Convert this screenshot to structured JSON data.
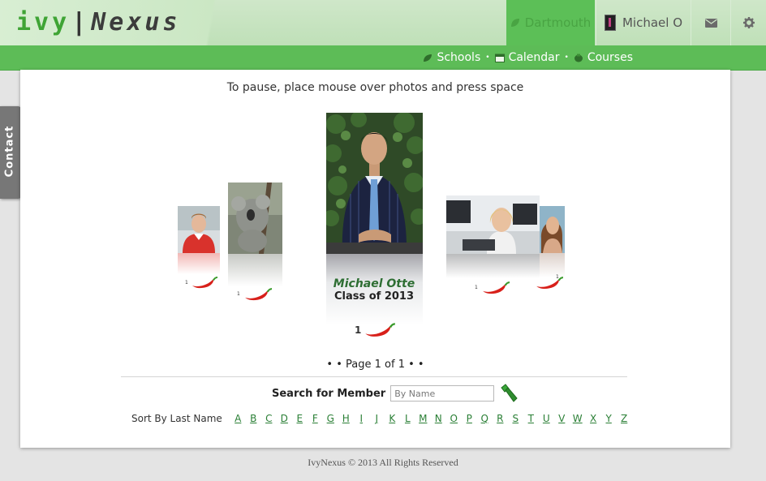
{
  "header": {
    "logo_ivy": "ivy",
    "logo_sep": "|",
    "logo_nexus": "Nexus",
    "school_tab": "Dartmouth",
    "user_tab": "Michael O",
    "mail_icon": "envelope-icon",
    "settings_icon": "gear-icon"
  },
  "subnav": {
    "schools": "Schools",
    "calendar": "Calendar",
    "courses": "Courses",
    "separator": "•"
  },
  "main": {
    "instructions": "To pause, place mouse over photos and press space",
    "featured": {
      "name": "Michael Otte",
      "class": "Class of 2013",
      "rating": "1"
    },
    "side_ratings": {
      "far_left": "1",
      "left": "1",
      "right": "1",
      "far_right": "1"
    },
    "pager": "• • Page 1 of 1 • •",
    "search": {
      "label": "Search for Member",
      "placeholder": "By Name"
    },
    "sort": {
      "label": "Sort By Last Name",
      "letters": [
        "A",
        "B",
        "C",
        "D",
        "E",
        "F",
        "G",
        "H",
        "I",
        "J",
        "K",
        "L",
        "M",
        "N",
        "O",
        "P",
        "Q",
        "R",
        "S",
        "T",
        "U",
        "V",
        "W",
        "X",
        "Y",
        "Z"
      ]
    }
  },
  "contact_tab": "Contact",
  "footer": "IvyNexus © 2013 All Rights Reserved",
  "colors": {
    "brand_green": "#5dbc57",
    "link_green": "#2a7f35",
    "header_light": "#cfe7c9"
  }
}
